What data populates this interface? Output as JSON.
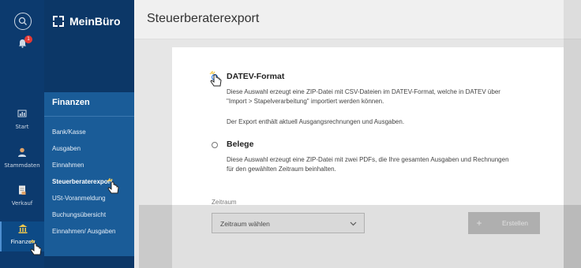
{
  "app": {
    "brand": "MeinBüro"
  },
  "rail": {
    "notification_count": "1",
    "items": [
      {
        "label": "Start",
        "icon": "chart-icon"
      },
      {
        "label": "Stammdaten",
        "icon": "person-icon"
      },
      {
        "label": "Verkauf",
        "icon": "document-icon"
      },
      {
        "label": "Finanzen",
        "icon": "bank-icon"
      }
    ]
  },
  "submenu": {
    "title": "Finanzen",
    "items": [
      "Bank/Kasse",
      "Ausgaben",
      "Einnahmen",
      "Steuerberaterexport",
      "USt-Voranmeldung",
      "Buchungsübersicht",
      "Einnahmen/ Ausgaben"
    ]
  },
  "page": {
    "title": "Steuerberaterexport"
  },
  "options": [
    {
      "title": "DATEV-Format",
      "selected": true,
      "desc_lines": [
        "Diese Auswahl erzeugt eine ZIP-Datei mit CSV-Dateien im DATEV-Format, welche in DATEV über",
        "\"Import > Stapelverarbeitung\" importiert werden können.",
        "Der Export enthält aktuell Ausgangsrechnungen und Ausgaben."
      ]
    },
    {
      "title": "Belege",
      "selected": false,
      "desc_lines": [
        "Diese Auswahl erzeugt eine ZIP-Datei mit zwei PDFs, die Ihre gesamten Ausgaben und Rechnungen",
        "für den gewählten Zeitraum beinhalten."
      ]
    }
  ],
  "period": {
    "label": "Zeitraum",
    "value": "Zeitraum wählen"
  },
  "buttons": {
    "plus": "+",
    "create": "Erstellen"
  },
  "colors": {
    "rail": "#0c3a6e",
    "submenu": "#1a5c98",
    "accent": "#1a73e8"
  }
}
